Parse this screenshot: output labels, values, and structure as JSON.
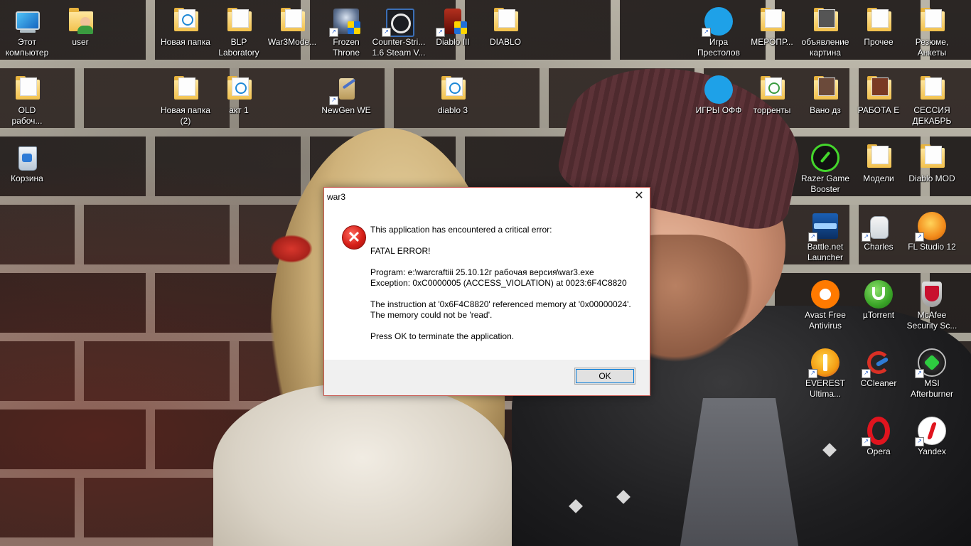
{
  "desktop": {
    "icons": [
      {
        "label": "Этот\nкомпьютер",
        "icon": "computer-icon"
      },
      {
        "label": "user",
        "icon": "user-folder-icon"
      },
      {
        "label": "Новая папка",
        "icon": "folder-icon"
      },
      {
        "label": "BLP\nLaboratory",
        "icon": "folder-icon"
      },
      {
        "label": "War3Mode...",
        "icon": "folder-icon"
      },
      {
        "label": "Frozen\nThrone",
        "icon": "frozen-throne-icon"
      },
      {
        "label": "Counter-Stri...\n1.6 Steam V...",
        "icon": "counter-strike-icon"
      },
      {
        "label": "Diablo III",
        "icon": "diablo-iii-icon"
      },
      {
        "label": "DIABLO",
        "icon": "folder-icon"
      },
      {
        "label": "Игра\nПрестолов",
        "icon": "blue-circle-icon"
      },
      {
        "label": "МЕРОПР...",
        "icon": "folder-icon"
      },
      {
        "label": "объявление\nкартина",
        "icon": "folder-icon"
      },
      {
        "label": "Прочее",
        "icon": "folder-icon"
      },
      {
        "label": "Резюме,\nАнкеты",
        "icon": "folder-icon"
      },
      {
        "label": "OLD\nрабоч...",
        "icon": "folder-icon"
      },
      {
        "label": "Новая папка\n(2)",
        "icon": "folder-icon"
      },
      {
        "label": "акт 1",
        "icon": "folder-icon"
      },
      {
        "label": "NewGen WE",
        "icon": "newgen-we-icon"
      },
      {
        "label": "diablo 3",
        "icon": "folder-icon"
      },
      {
        "label": "ИГРЫ ОФФ",
        "icon": "blue-circle-icon"
      },
      {
        "label": "торренты",
        "icon": "folder-icon"
      },
      {
        "label": "Вано дз",
        "icon": "folder-icon"
      },
      {
        "label": "РАБОТА Е",
        "icon": "folder-icon"
      },
      {
        "label": "СЕССИЯ\nДЕКАБРЬ",
        "icon": "folder-icon"
      },
      {
        "label": "Корзина",
        "icon": "recycle-bin-icon"
      },
      {
        "label": "Razer Game\nBooster",
        "icon": "razer-icon"
      },
      {
        "label": "Модели",
        "icon": "folder-icon"
      },
      {
        "label": "Diablo MOD",
        "icon": "folder-icon"
      },
      {
        "label": "Battle.net\nLauncher",
        "icon": "battle-net-icon"
      },
      {
        "label": "Charles",
        "icon": "charles-icon"
      },
      {
        "label": "FL Studio 12",
        "icon": "fl-studio-icon"
      },
      {
        "label": "Avast Free\nAntivirus",
        "icon": "avast-icon"
      },
      {
        "label": "µTorrent",
        "icon": "utorrent-icon"
      },
      {
        "label": "McAfee\nSecurity Sc...",
        "icon": "mcafee-icon"
      },
      {
        "label": "EVEREST\nUltima...",
        "icon": "everest-icon"
      },
      {
        "label": "CCleaner",
        "icon": "ccleaner-icon"
      },
      {
        "label": "MSI\nAfterburner",
        "icon": "msi-afterburner-icon"
      },
      {
        "label": "Opera",
        "icon": "opera-icon"
      },
      {
        "label": "Yandex",
        "icon": "yandex-icon"
      }
    ]
  },
  "dialog": {
    "title": "war3",
    "close_glyph": "✕",
    "error_glyph": "✕",
    "line1": "This application has encountered a critical error:",
    "line2": "FATAL ERROR!",
    "program": "Program:   e:\\warcraftiii 25.10.12г рабочая версия\\war3.exe",
    "exception": "Exception: 0xC0000005 (ACCESS_VIOLATION) at 0023:6F4C8820",
    "instruction1": "The instruction at '0x6F4C8820' referenced memory at '0x00000024'.",
    "instruction2": "The memory could not be 'read'.",
    "press_ok": "Press OK to terminate the application.",
    "ok_label": "OK"
  },
  "colors": {
    "dialog_border": "#c8574f",
    "error_red": "#d61f18",
    "button_focus": "#0078d7"
  }
}
